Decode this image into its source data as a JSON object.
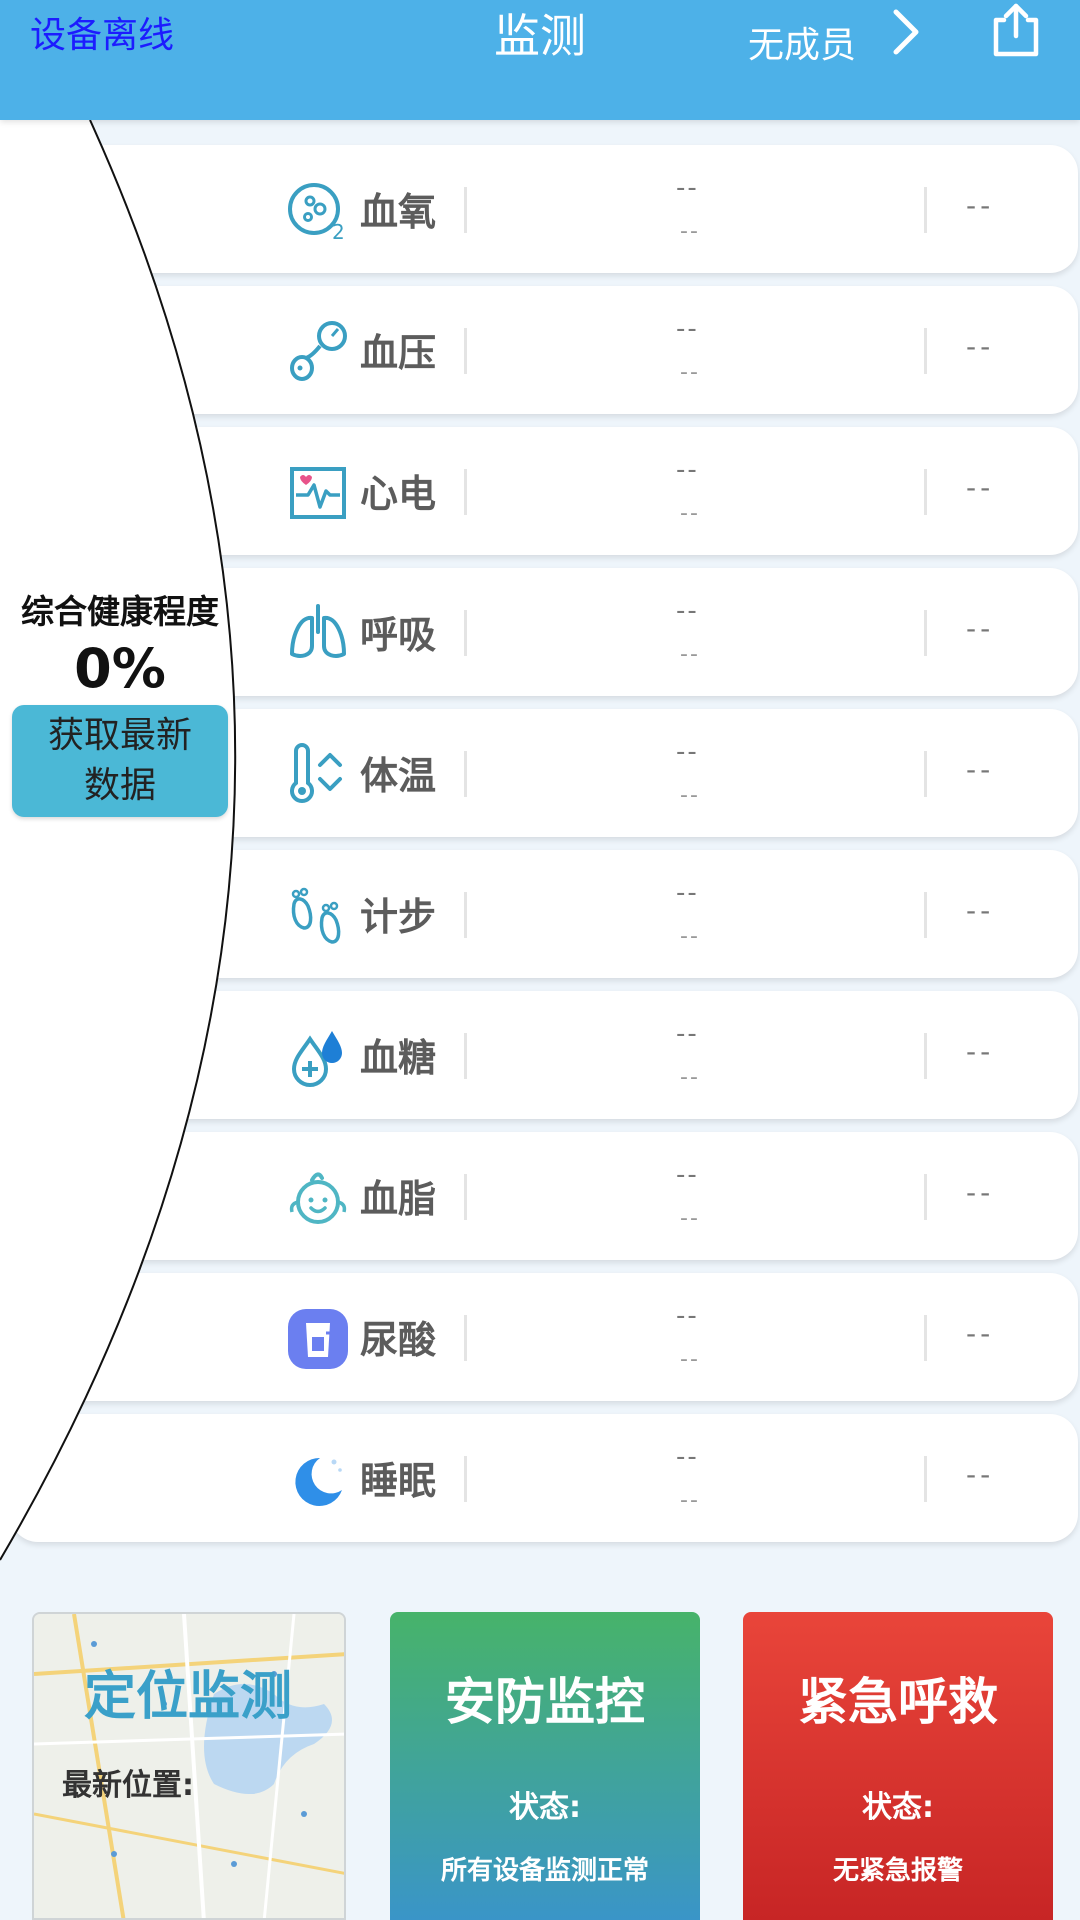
{
  "header": {
    "status": "设备离线",
    "title": "监测",
    "member": "无成员"
  },
  "metrics": [
    {
      "name": "血氧",
      "icon": "blood-oxygen-icon",
      "v1": "--",
      "v2": "--",
      "v3": "--"
    },
    {
      "name": "血压",
      "icon": "blood-pressure-icon",
      "v1": "--",
      "v2": "--",
      "v3": "--"
    },
    {
      "name": "心电",
      "icon": "ecg-icon",
      "v1": "--",
      "v2": "--",
      "v3": "--"
    },
    {
      "name": "呼吸",
      "icon": "lungs-icon",
      "v1": "--",
      "v2": "--",
      "v3": "--"
    },
    {
      "name": "体温",
      "icon": "thermometer-icon",
      "v1": "--",
      "v2": "--",
      "v3": "--"
    },
    {
      "name": "计步",
      "icon": "footprints-icon",
      "v1": "--",
      "v2": "--",
      "v3": "--"
    },
    {
      "name": "血糖",
      "icon": "blood-sugar-icon",
      "v1": "--",
      "v2": "--",
      "v3": "--"
    },
    {
      "name": "血脂",
      "icon": "blood-lipid-icon",
      "v1": "--",
      "v2": "--",
      "v3": "--"
    },
    {
      "name": "尿酸",
      "icon": "uric-acid-icon",
      "v1": "--",
      "v2": "--",
      "v3": "--"
    },
    {
      "name": "睡眠",
      "icon": "sleep-moon-icon",
      "v1": "--",
      "v2": "--",
      "v3": "--"
    }
  ],
  "health": {
    "title": "综合健康程度",
    "value": "0%",
    "refresh_label_1": "获取最新",
    "refresh_label_2": "数据"
  },
  "location_card": {
    "title": "定位监测",
    "subtitle": "最新位置:"
  },
  "security_card": {
    "title": "安防监控",
    "status_label": "状态:",
    "status": "所有设备监测正常"
  },
  "emergency_card": {
    "title": "紧急呼救",
    "status_label": "状态:",
    "status": "无紧急报警"
  },
  "colors": {
    "header": "#4db1e8",
    "icon_teal": "#3a9fc2",
    "security_top": "#47b36a",
    "security_bottom": "#3a95c8",
    "emergency": "#e9453a"
  }
}
